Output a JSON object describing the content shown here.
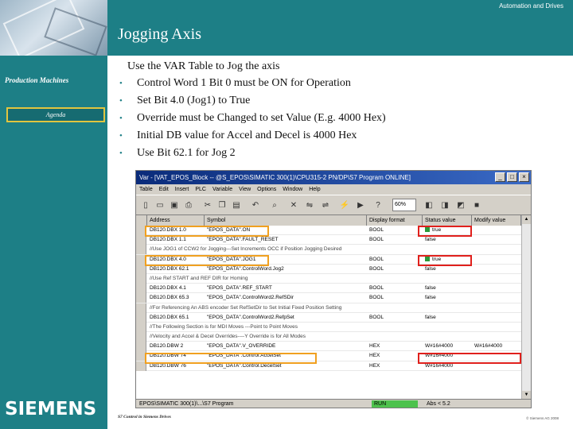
{
  "header": {
    "caption": "Automation and Drives",
    "title": "Jogging Axis"
  },
  "sidebar": {
    "section_label": "Production Machines",
    "agenda_label": "Agenda",
    "logo_text": "SIEMENS"
  },
  "content": {
    "intro": "Use the VAR Table to Jog the axis",
    "bullets": [
      "Control Word 1 Bit 0 must be ON for Operation",
      "Set Bit 4.0 (Jog1) to True",
      "Override must be Changed to set Value (E.g. 4000 Hex)",
      "Initial DB value for Accel and Decel is 4000 Hex",
      "Use Bit 62.1 for Jog 2"
    ]
  },
  "window": {
    "title": "Var - [VAT_EPOS_Block -- @S_EPOS\\SIMATIC 300(1)\\CPU315-2 PN/DP\\S7 Program ONLINE]",
    "menu": [
      "Table",
      "Edit",
      "Insert",
      "PLC",
      "Variable",
      "View",
      "Options",
      "Window",
      "Help"
    ],
    "zoom": "60%",
    "columns": [
      "Address",
      "Symbol",
      "Display format",
      "Status value",
      "Modify value"
    ],
    "rows": [
      {
        "type": "data",
        "address": "DB120.DBX 1.0",
        "symbol": "\"EPOS_DATA\".ON",
        "format": "BOOL",
        "status": "true",
        "status_on": true
      },
      {
        "type": "data",
        "address": "DB120.DBX 1.1",
        "symbol": "\"EPOS_DATA\".FAULT_RESET",
        "format": "BOOL",
        "status": "false",
        "status_on": false
      },
      {
        "type": "comment",
        "text": "//Use JOG1 of CCW2 for Jogging---Set Increments OCC if Position Jogging Desired"
      },
      {
        "type": "data",
        "address": "DB120.DBX 4.0",
        "symbol": "\"EPOS_DATA\".JOG1",
        "format": "BOOL",
        "status": "true",
        "status_on": true
      },
      {
        "type": "data",
        "address": "DB120.DBX 62.1",
        "symbol": "\"EPOS_DATA\".ControlWord.Jog2",
        "format": "BOOL",
        "status": "false",
        "status_on": false
      },
      {
        "type": "comment",
        "text": "//Use Ref START and REF DIR for Homing"
      },
      {
        "type": "data",
        "address": "DB120.DBX 4.1",
        "symbol": "\"EPOS_DATA\".REF_START",
        "format": "BOOL",
        "status": "false",
        "status_on": false
      },
      {
        "type": "data",
        "address": "DB120.DBX 65.3",
        "symbol": "\"EPOS_DATA\".ControlWord2.RefSDir",
        "format": "BOOL",
        "status": "false",
        "status_on": false
      },
      {
        "type": "comment",
        "text": "//For Referencing An ABS encoder Set RefSetDir to Set Initial Fixed Position Setting"
      },
      {
        "type": "data",
        "address": "DB120.DBX 65.1",
        "symbol": "\"EPOS_DATA\".ControlWord2.RefpSet",
        "format": "BOOL",
        "status": "false",
        "status_on": false
      },
      {
        "type": "comment",
        "text": "//The Following Section is for MDI Moves ---Point to Point Moves"
      },
      {
        "type": "comment",
        "text": "//Velocity and Accel & Decel Overrides----Y Override is for All Modes"
      },
      {
        "type": "data",
        "address": "DB120.DBW 2",
        "symbol": "\"EPOS_DATA\".V_OVERRIDE",
        "format": "HEX",
        "status": "W#16#4000",
        "status_on": false,
        "modify": "W#16#4000"
      },
      {
        "type": "data",
        "address": "DB120.DBW 74",
        "symbol": "\"EPOS_DATA\".Control.AccelSet",
        "format": "HEX",
        "status": "W#16#4000",
        "status_on": false
      },
      {
        "type": "data",
        "address": "DB120.DBW 76",
        "symbol": "\"EPOS_DATA\".Control.DecelSet",
        "format": "HEX",
        "status": "W#16#4000",
        "status_on": false
      }
    ],
    "status_path": "EPOS\\SIMATIC 300(1)\\...\\S7 Program",
    "status_run": "RUN",
    "status_abs": "Abs < 5.2"
  },
  "footer": {
    "left": "S7 Control in Siemens Drives",
    "right": "© Siemens AG 2008"
  },
  "colors": {
    "teal": "#1d7f86",
    "highlight_orange": "#f0a020",
    "highlight_red": "#e0201c",
    "status_green": "#2a9a3a"
  }
}
